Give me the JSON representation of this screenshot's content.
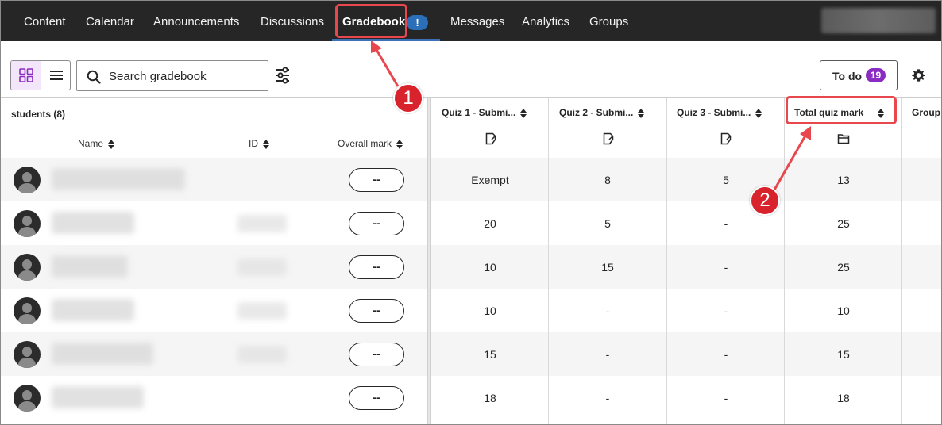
{
  "nav": {
    "items": [
      {
        "label": "Content"
      },
      {
        "label": "Calendar"
      },
      {
        "label": "Announcements"
      },
      {
        "label": "Discussions"
      },
      {
        "label": "Gradebook",
        "active": true,
        "badge": "!"
      },
      {
        "label": "Messages"
      },
      {
        "label": "Analytics"
      },
      {
        "label": "Groups"
      }
    ]
  },
  "toolbar": {
    "search_placeholder": "Search gradebook",
    "todo_label": "To do",
    "todo_count": "19",
    "icons": [
      "grid-view-icon",
      "list-view-icon",
      "search-icon",
      "filter-icon",
      "gear-icon"
    ]
  },
  "table": {
    "students_header": "students (8)",
    "name_header": "Name",
    "id_header": "ID",
    "overall_header": "Overall mark",
    "columns": [
      {
        "label": "Quiz 1 - Submi...",
        "icon": "assignment-icon"
      },
      {
        "label": "Quiz 2 - Submi...",
        "icon": "assignment-icon"
      },
      {
        "label": "Quiz 3 - Submi...",
        "icon": "assignment-icon"
      },
      {
        "label": "Total quiz mark",
        "icon": "folder-icon"
      },
      {
        "label": "Group"
      }
    ],
    "rows": [
      {
        "overall": "--",
        "q1": "Exempt",
        "q2": "8",
        "q3": "5",
        "total": "13"
      },
      {
        "overall": "--",
        "q1": "20",
        "q2": "5",
        "q3": "-",
        "total": "25"
      },
      {
        "overall": "--",
        "q1": "10",
        "q2": "15",
        "q3": "-",
        "total": "25"
      },
      {
        "overall": "--",
        "q1": "10",
        "q2": "-",
        "q3": "-",
        "total": "10"
      },
      {
        "overall": "--",
        "q1": "15",
        "q2": "-",
        "q3": "-",
        "total": "15"
      },
      {
        "overall": "--",
        "q1": "18",
        "q2": "-",
        "q3": "-",
        "total": "18"
      }
    ]
  },
  "callouts": [
    {
      "number": "1"
    },
    {
      "number": "2"
    }
  ],
  "colors": {
    "nav_bg": "#262626",
    "accent_purple": "#8a2bc2",
    "badge_blue": "#2a6fb7",
    "callout_red": "#d9232c"
  }
}
